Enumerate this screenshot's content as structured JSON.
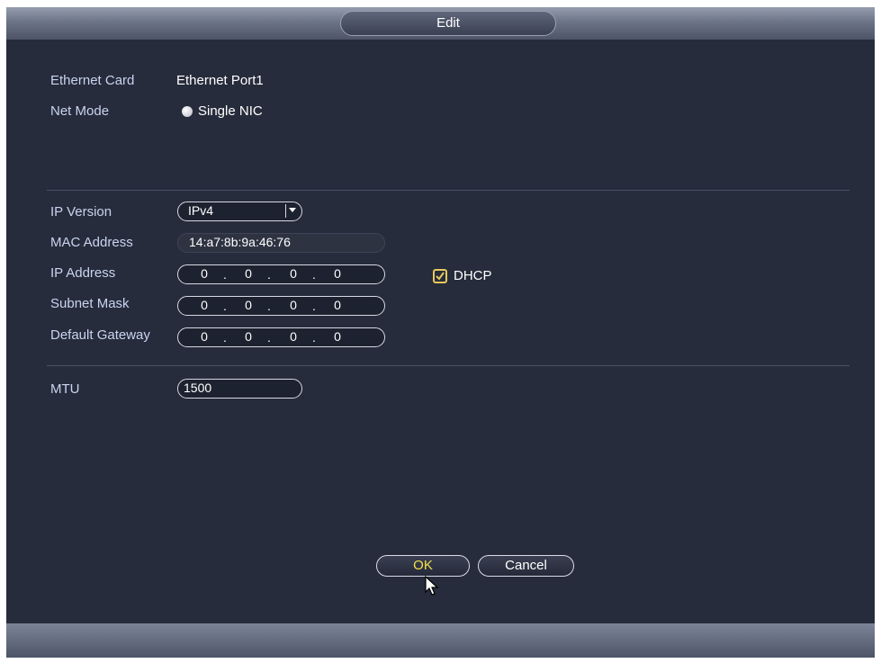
{
  "dialog": {
    "title": "Edit"
  },
  "fields": {
    "ethernet_card": {
      "label": "Ethernet Card",
      "value": "Ethernet Port1"
    },
    "net_mode": {
      "label": "Net Mode",
      "option": "Single NIC"
    },
    "ip_version": {
      "label": "IP Version",
      "selected": "IPv4"
    },
    "mac_address": {
      "label": "MAC Address",
      "value": "14:a7:8b:9a:46:76"
    },
    "ip_address": {
      "label": "IP Address",
      "octets": [
        "0",
        "0",
        "0",
        "0"
      ]
    },
    "subnet_mask": {
      "label": "Subnet Mask",
      "octets": [
        "0",
        "0",
        "0",
        "0"
      ]
    },
    "default_gateway": {
      "label": "Default Gateway",
      "octets": [
        "0",
        "0",
        "0",
        "0"
      ]
    },
    "dhcp": {
      "label": "DHCP",
      "checked": true
    },
    "mtu": {
      "label": "MTU",
      "value": "1500"
    }
  },
  "ip_separator": ".",
  "buttons": {
    "ok": "OK",
    "cancel": "Cancel"
  },
  "colors": {
    "background": "#272c3c",
    "label_text": "#c9d4f0",
    "ok_text": "#f2e04a",
    "checkbox_accent": "#e6c95a"
  }
}
